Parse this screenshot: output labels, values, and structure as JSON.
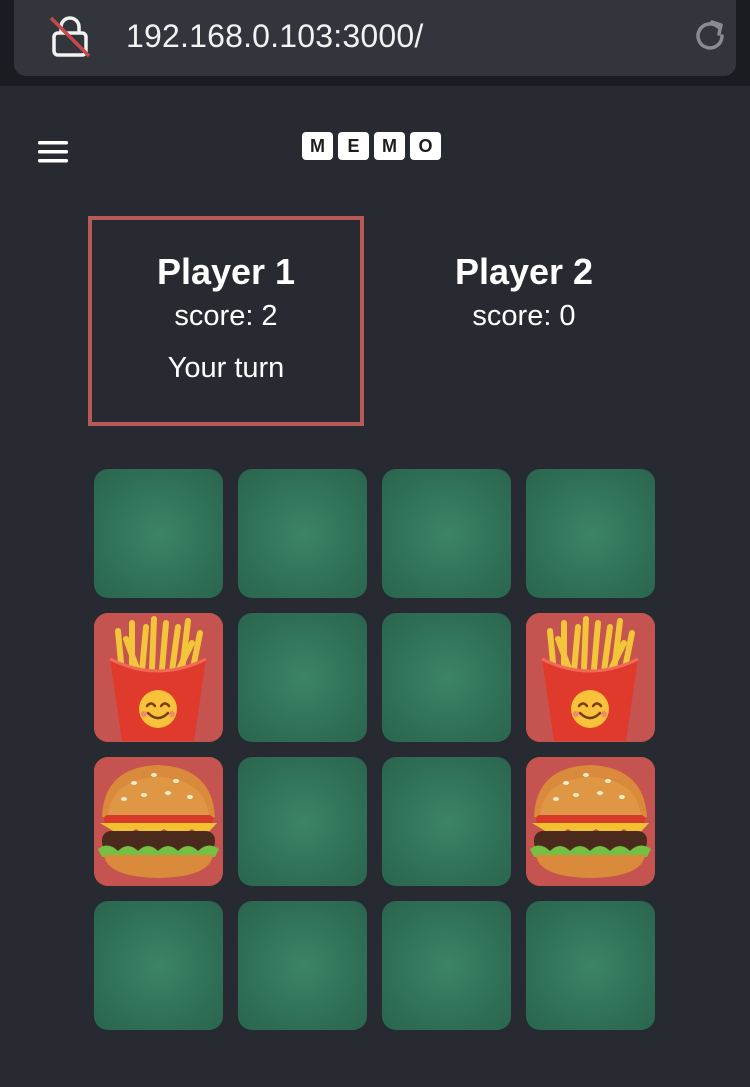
{
  "browser": {
    "url": "192.168.0.103:3000/",
    "lock_icon": "lock-slashed-icon",
    "reload_icon": "reload-icon"
  },
  "app": {
    "menu_icon": "hamburger-menu-icon",
    "logo_letters": [
      "M",
      "E",
      "M",
      "O"
    ],
    "colors": {
      "background": "#282a31",
      "active_player_border": "#b85a57",
      "card_back": "#2e6d55",
      "card_front": "#c5534f"
    }
  },
  "players": [
    {
      "name": "Player 1",
      "score": "score: 2",
      "status": "Your turn",
      "active": true
    },
    {
      "name": "Player 2",
      "score": "score: 0",
      "status": "",
      "active": false
    }
  ],
  "board": {
    "rows": 4,
    "cols": 4,
    "cards": [
      [
        "hidden",
        "hidden",
        "hidden",
        "hidden"
      ],
      [
        "fries",
        "hidden",
        "hidden",
        "fries"
      ],
      [
        "burger",
        "hidden",
        "hidden",
        "burger"
      ],
      [
        "hidden",
        "hidden",
        "hidden",
        "hidden"
      ]
    ]
  }
}
